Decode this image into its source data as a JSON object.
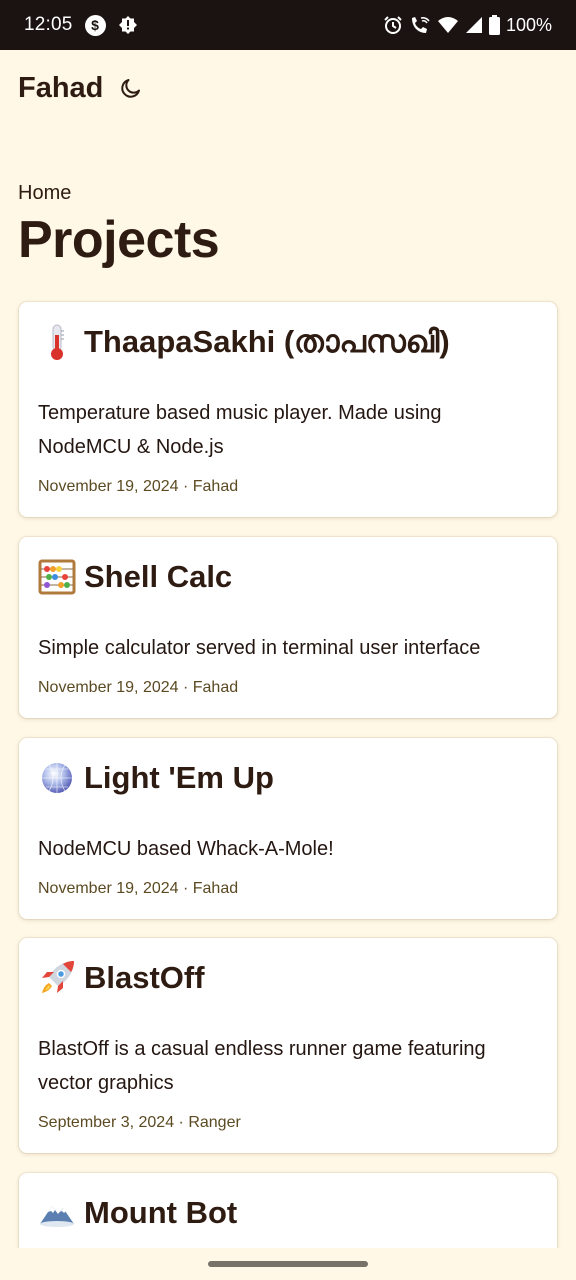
{
  "status_bar": {
    "time": "12:05",
    "battery_text": "100%",
    "left_icons": [
      "dollar-circle-icon",
      "gear-badge-icon"
    ],
    "right_icons": [
      "alarm-icon",
      "wifi-call-icon",
      "wifi-icon",
      "signal-icon",
      "battery-icon"
    ]
  },
  "header": {
    "site_title": "Fahad",
    "theme_toggle_icon": "moon-icon"
  },
  "breadcrumb": "Home",
  "page_title": "Projects",
  "projects": [
    {
      "emoji_icon": "thermometer-icon",
      "title": "ThaapaSakhi (താപസഖി)",
      "description": "Temperature based music player. Made using NodeMCU & Node.js",
      "date": "November 19, 2024",
      "author": "Fahad"
    },
    {
      "emoji_icon": "abacus-icon",
      "title": "Shell Calc",
      "description": "Simple calculator served in terminal user interface",
      "date": "November 19, 2024",
      "author": "Fahad"
    },
    {
      "emoji_icon": "mirror-ball-icon",
      "title": "Light 'Em Up",
      "description": "NodeMCU based Whack-A-Mole!",
      "date": "November 19, 2024",
      "author": "Fahad"
    },
    {
      "emoji_icon": "rocket-icon",
      "title": "BlastOff",
      "description": "BlastOff is a casual endless runner game featuring vector graphics",
      "date": "September 3, 2024",
      "author": "Ranger"
    },
    {
      "emoji_icon": "snow-mountain-icon",
      "title": "Mount Bot",
      "description": "",
      "date": "",
      "author": ""
    }
  ],
  "meta_separator": " · ",
  "colors": {
    "background": "#fff8e7",
    "text": "#2e1b12",
    "meta": "#5b4a22",
    "status_bar": "#1b1311"
  }
}
